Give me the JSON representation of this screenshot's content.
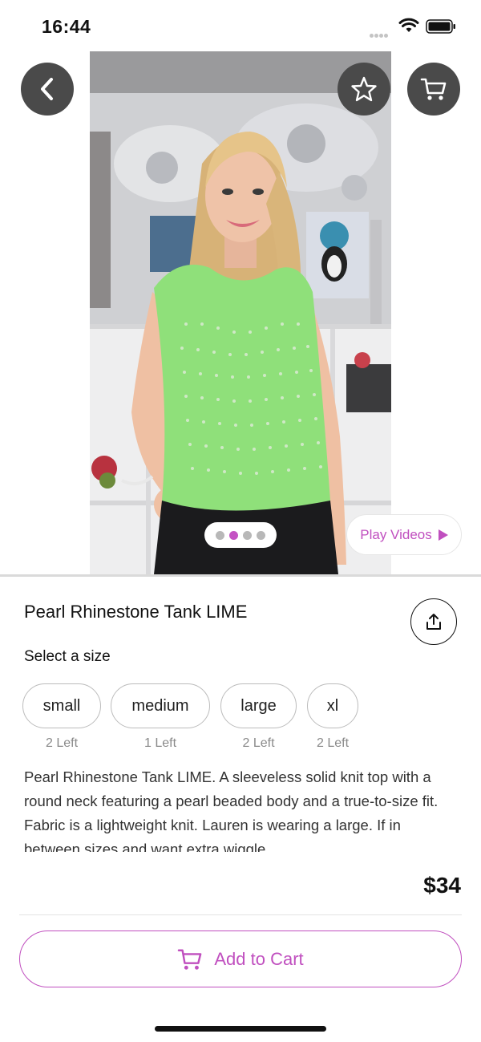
{
  "status_bar": {
    "time": "16:44",
    "icons": [
      "signal-dots-icon",
      "wifi-icon",
      "battery-icon"
    ]
  },
  "header": {
    "back_icon": "chevron-left-icon",
    "favorite_icon": "star-icon",
    "cart_icon": "cart-icon"
  },
  "gallery": {
    "image_count": 4,
    "active_index": 1,
    "play_videos_label": "Play Videos"
  },
  "product": {
    "title": "Pearl Rhinestone Tank LIME",
    "select_size_label": "Select a size",
    "sizes": [
      {
        "label": "small",
        "stock": "2 Left"
      },
      {
        "label": "medium",
        "stock": "1 Left"
      },
      {
        "label": "large",
        "stock": "2 Left"
      },
      {
        "label": "xl",
        "stock": "2 Left"
      }
    ],
    "description": "Pearl Rhinestone Tank LIME. A sleeveless solid knit top with a round neck featuring a pearl beaded body and a true-to-size fit. Fabric is a lightweight knit. Lauren is wearing a large. If in between sizes and want extra wiggle",
    "price": "$34"
  },
  "footer": {
    "add_to_cart_label": "Add to Cart"
  },
  "colors": {
    "accent": "#c04fbf",
    "dark_button": "#4a4a4a",
    "top_color": "#8fe07a"
  }
}
